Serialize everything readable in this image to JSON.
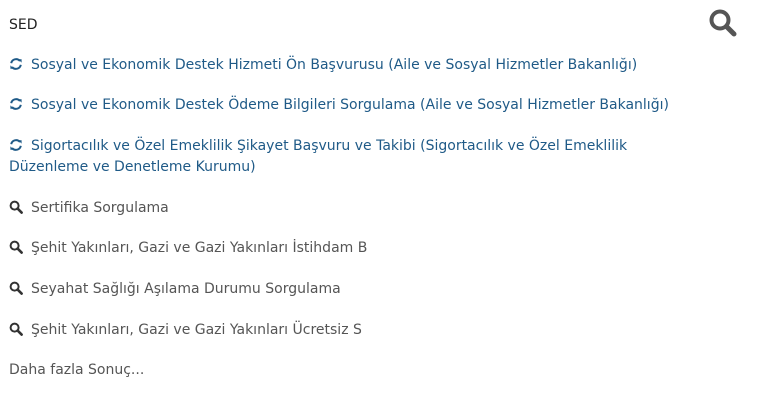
{
  "search": {
    "value": "SED",
    "icon": "search-icon",
    "icon_color": "#555555"
  },
  "results": [
    {
      "type": "service",
      "icon": "refresh-icon",
      "label": "Sosyal ve Ekonomik Destek Hizmeti Ön Başvurusu (Aile ve Sosyal Hizmetler Bakanlığı)"
    },
    {
      "type": "service",
      "icon": "refresh-icon",
      "label": "Sosyal ve Ekonomik Destek Ödeme Bilgileri Sorgulama (Aile ve Sosyal Hizmetler Bakanlığı)"
    },
    {
      "type": "service",
      "icon": "refresh-icon",
      "label": "Sigortacılık ve Özel Emeklilik Şikayet Başvuru ve Takibi (Sigortacılık ve Özel Emeklilik Düzenleme ve Denetleme Kurumu)"
    },
    {
      "type": "query",
      "icon": "search-icon",
      "label": "Sertifika Sorgulama"
    },
    {
      "type": "query",
      "icon": "search-icon",
      "label": "Şehit Yakınları, Gazi ve Gazi Yakınları İstihdam B"
    },
    {
      "type": "query",
      "icon": "search-icon",
      "label": "Seyahat Sağlığı Aşılama Durumu Sorgulama"
    },
    {
      "type": "query",
      "icon": "search-icon",
      "label": "Şehit Yakınları, Gazi ve Gazi Yakınları Ücretsiz S"
    }
  ],
  "more_label": "Daha fazla Sonuç...",
  "colors": {
    "service_link": "#1f5a87",
    "query_text": "#555555"
  }
}
